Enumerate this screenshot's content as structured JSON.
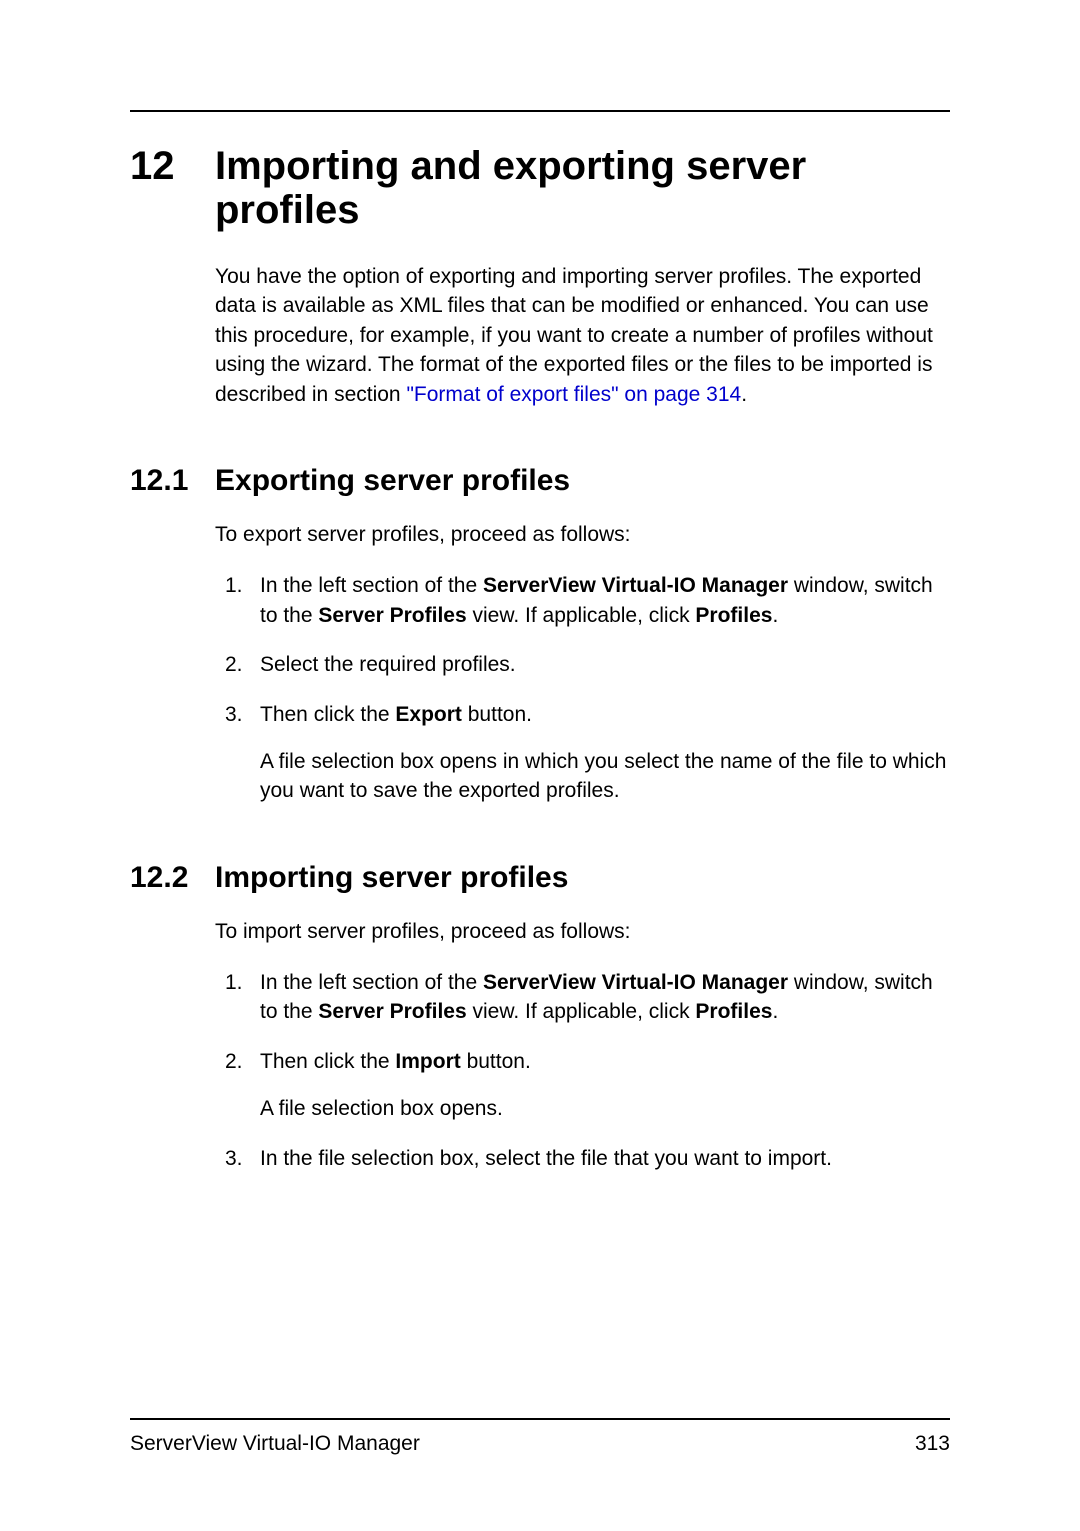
{
  "chapter": {
    "number": "12",
    "title": "Importing and exporting server profiles"
  },
  "intro": {
    "part1": "You have the option of exporting and importing server profiles. The exported data is available as XML files that can be modified or enhanced. You can use this procedure, for example, if you want to create a number of profiles without using the wizard. The format of the exported files or the files to be imported is described in section ",
    "link": "\"Format of export files\" on page 314",
    "part2": "."
  },
  "section1": {
    "number": "12.1",
    "title": "Exporting server profiles",
    "intro": "To export server profiles, proceed as follows:",
    "steps": {
      "s1": {
        "num": "1.",
        "pre": "In the left section of the ",
        "b1": "ServerView Virtual-IO Manager",
        "mid1": " window, switch to the ",
        "b2": "Server Profiles",
        "mid2": " view. If applicable, click ",
        "b3": "Profiles",
        "end": "."
      },
      "s2": {
        "num": "2.",
        "text": "Select the required profiles."
      },
      "s3": {
        "num": "3.",
        "pre": "Then click the ",
        "b1": "Export",
        "end": " button.",
        "sub": "A file selection box opens in which you select the name of the file to which you want to save the exported profiles."
      }
    }
  },
  "section2": {
    "number": "12.2",
    "title": "Importing server profiles",
    "intro": "To import server profiles, proceed as follows:",
    "steps": {
      "s1": {
        "num": "1.",
        "pre": "In the left section of the ",
        "b1": "ServerView Virtual-IO Manager",
        "mid1": " window, switch to the ",
        "b2": "Server Profiles",
        "mid2": " view. If applicable, click ",
        "b3": "Profiles",
        "end": "."
      },
      "s2": {
        "num": "2.",
        "pre": "Then click the ",
        "b1": "Import",
        "end": " button.",
        "sub": "A file selection box opens."
      },
      "s3": {
        "num": "3.",
        "text": "In the file selection box, select the file that you want to import."
      }
    }
  },
  "footer": {
    "left": "ServerView Virtual-IO Manager",
    "right": "313"
  }
}
